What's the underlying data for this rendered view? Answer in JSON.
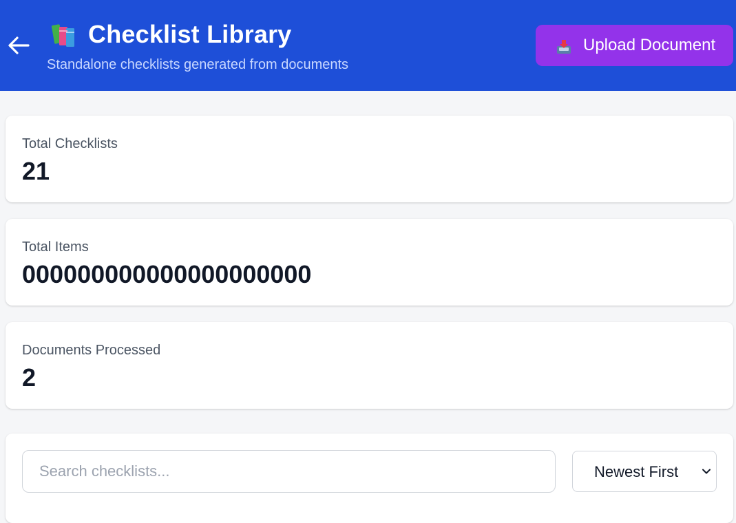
{
  "header": {
    "title": "Checklist Library",
    "subtitle": "Standalone checklists generated from documents",
    "back_icon": "arrow-left-icon",
    "title_icon": "books-icon",
    "upload_button": {
      "label": "Upload Document",
      "icon": "inbox-tray-icon"
    }
  },
  "stats": [
    {
      "label": "Total Checklists",
      "value": "21"
    },
    {
      "label": "Total Items",
      "value": "000000000000000000000"
    },
    {
      "label": "Documents Processed",
      "value": "2"
    }
  ],
  "filters": {
    "search_placeholder": "Search checklists...",
    "search_value": "",
    "sort_selected": "Newest First"
  },
  "colors": {
    "header_bg": "#1e4fd8",
    "upload_button_bg": "#9333ea",
    "page_bg": "#f5f6f8",
    "card_bg": "#ffffff"
  }
}
